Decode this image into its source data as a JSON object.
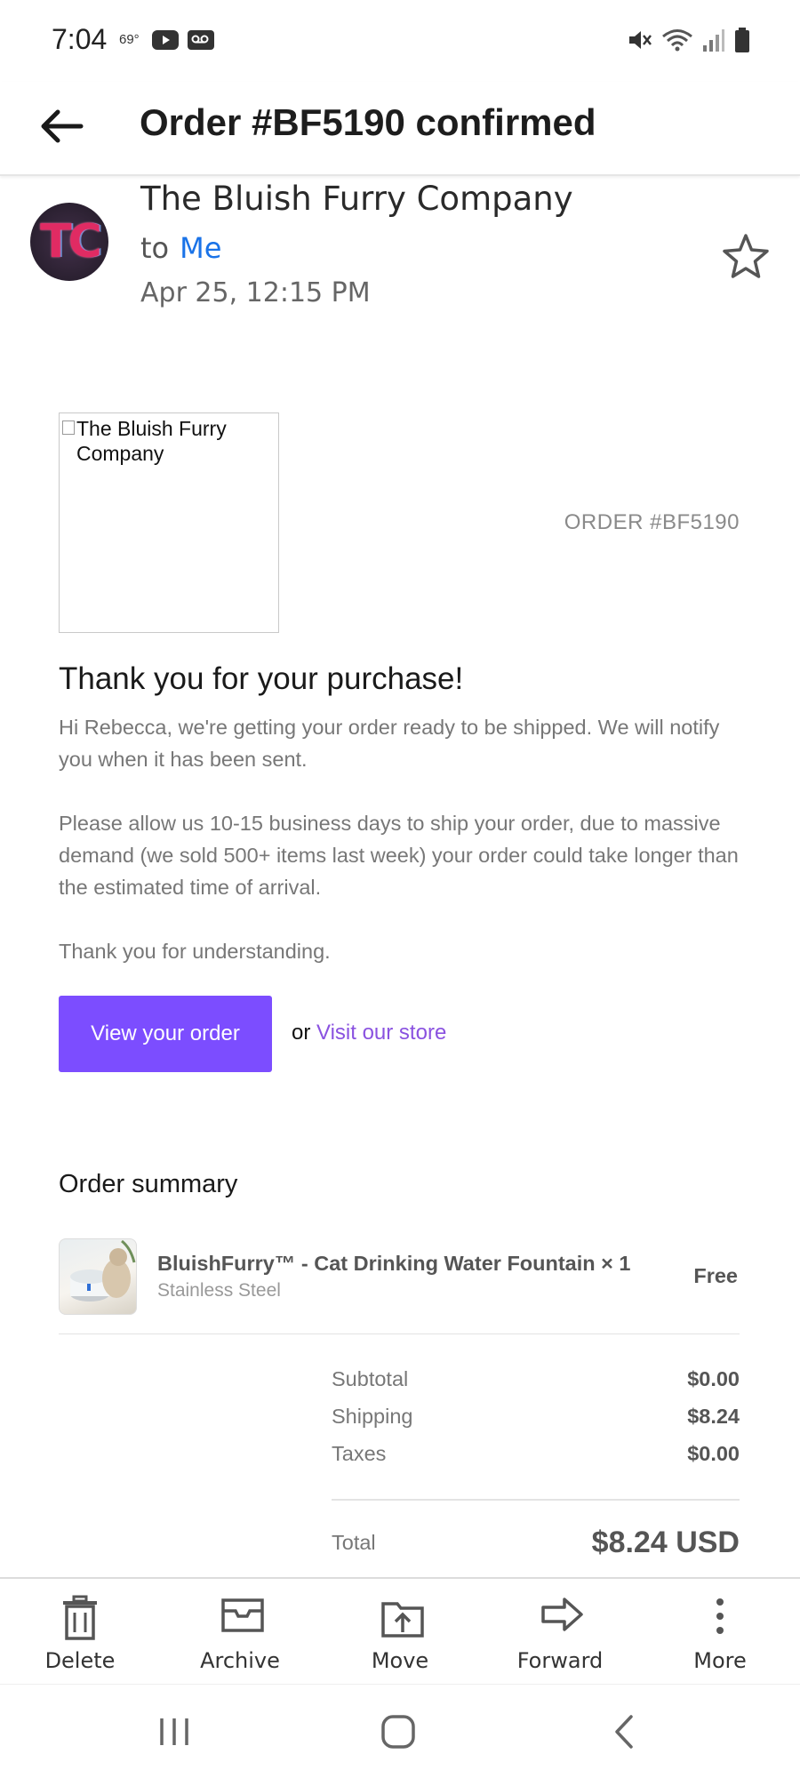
{
  "status_bar": {
    "time": "7:04",
    "temperature": "69°",
    "left_icons": [
      "youtube-icon",
      "voicemail-icon"
    ],
    "right_icons": [
      "mute-icon",
      "wifi-icon",
      "signal-icon",
      "battery-icon"
    ]
  },
  "header": {
    "back_icon": "back-arrow-icon",
    "title": "Order #BF5190 confirmed"
  },
  "message": {
    "avatar_initials": "TC",
    "sender": "The Bluish Furry Company",
    "to_prefix": "to",
    "recipient": "Me",
    "date": "Apr 25, 12:15 PM",
    "star_icon": "star-outline-icon"
  },
  "email": {
    "logo_alt": "The Bluish Furry Company",
    "order_number": "ORDER #BF5190",
    "heading": "Thank you for your purchase!",
    "paragraph1": "Hi Rebecca, we're getting your order ready to be shipped. We will notify you when it has been sent.",
    "paragraph2": "Please allow us 10-15 business days to ship your order, due to massive demand (we sold 500+ items last week) your order could take longer than the estimated time of arrival.",
    "paragraph3": "Thank you for understanding.",
    "view_order_label": "View your order",
    "or_text": "or",
    "store_link": "Visit our store",
    "summary_heading": "Order summary",
    "product": {
      "name": "BluishFurry™ - Cat Drinking Water Fountain × 1",
      "variant": "Stainless Steel",
      "price": "Free"
    },
    "costs": [
      {
        "label": "Subtotal",
        "value": "$0.00"
      },
      {
        "label": "Shipping",
        "value": "$8.24"
      },
      {
        "label": "Taxes",
        "value": "$0.00"
      }
    ],
    "total_label": "Total",
    "total_value": "$8.24 USD",
    "accent_color": "#7c4dff"
  },
  "actions": [
    {
      "label": "Delete",
      "icon": "trash-icon"
    },
    {
      "label": "Archive",
      "icon": "archive-icon"
    },
    {
      "label": "Move",
      "icon": "move-icon"
    },
    {
      "label": "Forward",
      "icon": "forward-icon"
    },
    {
      "label": "More",
      "icon": "more-vertical-icon"
    }
  ],
  "system_nav": [
    "recents-icon",
    "home-icon",
    "back-icon"
  ]
}
